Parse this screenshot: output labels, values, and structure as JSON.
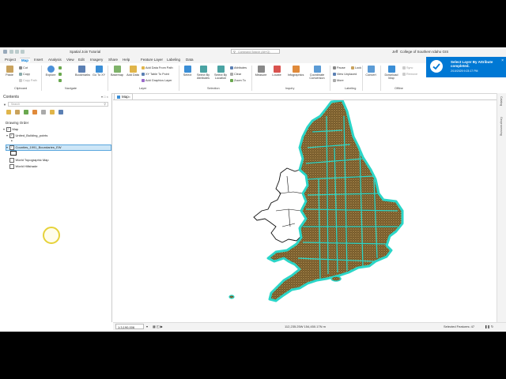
{
  "window": {
    "project_title": "Spatial Join Tutorial",
    "command_search_placeholder": "Command Search (Alt+Q)",
    "user": "Jeff",
    "org": "College of Southern Idaho GIS"
  },
  "tabs": [
    "Project",
    "Map",
    "Insert",
    "Analysis",
    "View",
    "Edit",
    "Imagery",
    "Share",
    "Help",
    "Feature Layer",
    "Labeling",
    "Data"
  ],
  "active_tab": "Map",
  "ribbon": {
    "clipboard": {
      "label": "Clipboard",
      "paste": "Paste",
      "cut": "Cut",
      "copy": "Copy",
      "copy_path": "Copy Path"
    },
    "navigate": {
      "label": "Navigate",
      "explore": "Explore",
      "bookmarks": "Bookmarks",
      "goto": "Go To XY"
    },
    "layer": {
      "label": "Layer",
      "basemap": "Basemap",
      "add_data": "Add Data",
      "add_from_path": "Add Data From Path",
      "xy_table": "XY Table To Point",
      "add_graphics": "Add Graphics Layer"
    },
    "selection": {
      "label": "Selection",
      "select": "Select",
      "by_attributes": "Select By Attributes",
      "by_location": "Select By Location",
      "attributes": "Attributes",
      "clear": "Clear",
      "zoom_to": "Zoom To"
    },
    "inquiry": {
      "label": "Inquiry",
      "measure": "Measure",
      "locate": "Locate",
      "infographics": "Infographics",
      "coord_conv": "Coordinate Conversion"
    },
    "labeling": {
      "label": "Labeling",
      "pause": "Pause",
      "lock": "Lock",
      "view_unplaced": "View Unplaced",
      "more": "More"
    },
    "convert": {
      "label": "Convert"
    },
    "offline": {
      "label": "Offline",
      "download": "Download Map",
      "sync": "Sync",
      "remove": "Remove"
    }
  },
  "notification": {
    "title_line1": "Select Layer By Attribute",
    "title_line2": "completed.",
    "timestamp": "2/10/2025 9:23:17 PM"
  },
  "contents": {
    "title": "Contents",
    "search_placeholder": "Search",
    "drawing_order": "Drawing Order",
    "layers": [
      {
        "name": "Map",
        "checked": true
      },
      {
        "name": "United_Building_points",
        "checked": true
      },
      {
        "name": "Counties_1991_Boundaries_EW",
        "checked": true
      },
      {
        "name": "World Topographic Map",
        "checked": false
      },
      {
        "name": "World Hillshade",
        "checked": false
      }
    ]
  },
  "map_tab": {
    "label": "Map"
  },
  "right_panes": [
    "Catalog",
    "Geoprocessing"
  ],
  "status": {
    "scale": "1:3,190,006",
    "coordinates": "112,235.25W 154,450.17N m",
    "selected": "Selected Features: 47"
  },
  "colors": {
    "accent": "#0078d4",
    "county_fill": "#7a5d2e",
    "selection_outline": "#2ad6c8"
  }
}
